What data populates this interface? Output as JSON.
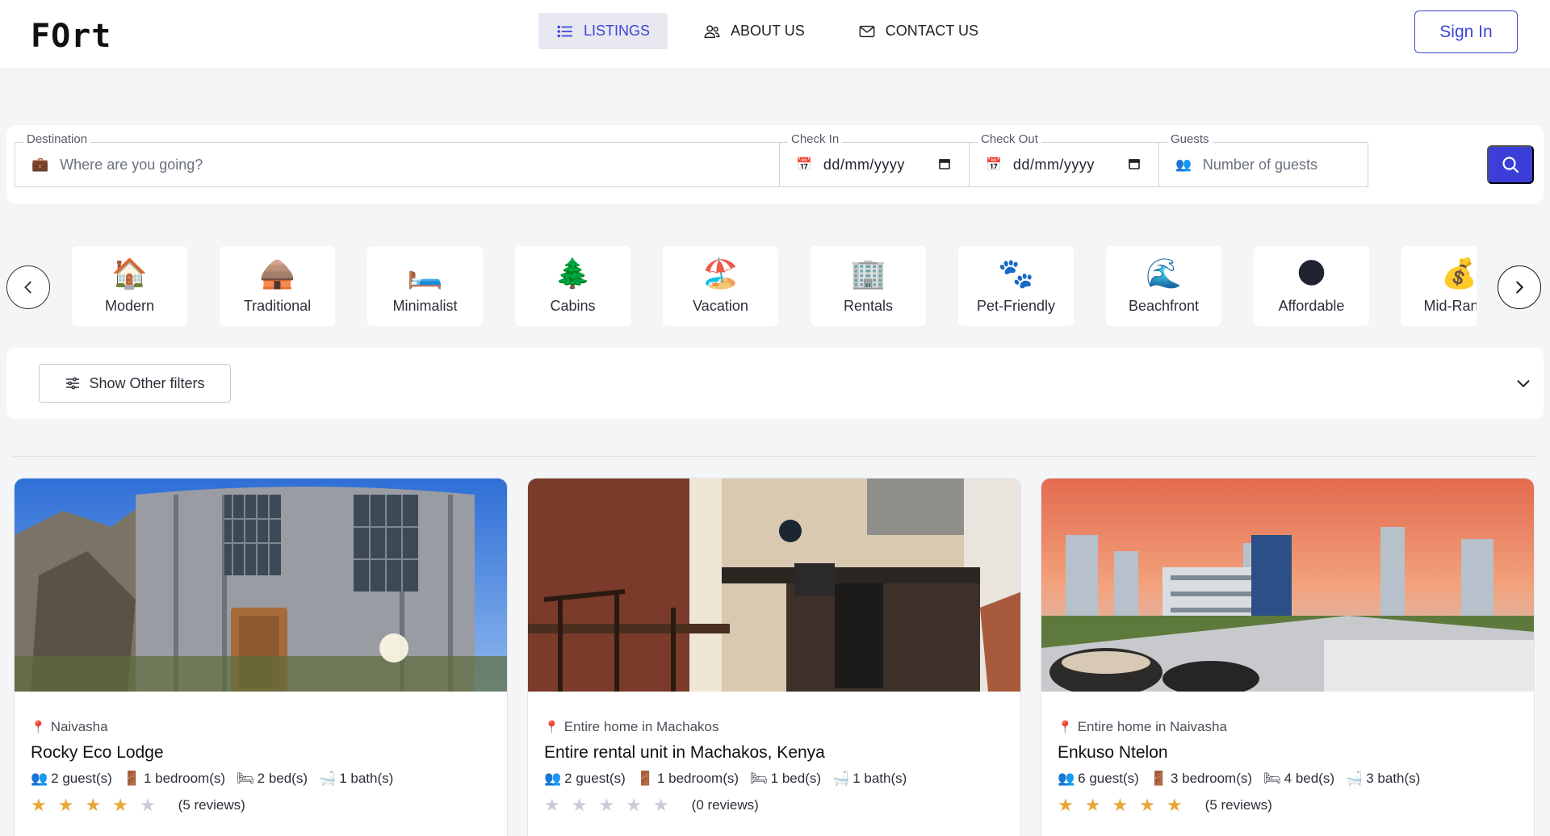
{
  "header": {
    "logo": "FOrt",
    "nav": [
      {
        "label": "LISTINGS",
        "icon": "list-icon",
        "active": true
      },
      {
        "label": "ABOUT US",
        "icon": "users-icon",
        "active": false
      },
      {
        "label": "CONTACT US",
        "icon": "mail-icon",
        "active": false
      }
    ],
    "signin_label": "Sign In"
  },
  "search": {
    "destination": {
      "label": "Destination",
      "placeholder": "Where are you going?",
      "icon": "luggage-icon"
    },
    "check_in": {
      "label": "Check In",
      "value": "dd/mm/yyyy",
      "icon": "calendar-emoji-icon"
    },
    "check_out": {
      "label": "Check Out",
      "value": "dd/mm/yyyy",
      "icon": "calendar-emoji-icon"
    },
    "guests": {
      "label": "Guests",
      "placeholder": "Number of guests",
      "icon": "people-icon"
    },
    "button_icon": "search-icon"
  },
  "categories": [
    {
      "label": "Modern",
      "emoji": "🏠"
    },
    {
      "label": "Traditional",
      "emoji": "🛖"
    },
    {
      "label": "Minimalist",
      "emoji": "🛏️"
    },
    {
      "label": "Cabins",
      "emoji": "🌲"
    },
    {
      "label": "Vacation",
      "emoji": "🏖️"
    },
    {
      "label": "Rentals",
      "emoji": "🏢"
    },
    {
      "label": "Pet-Friendly",
      "emoji": "🐾"
    },
    {
      "label": "Beachfront",
      "emoji": "🌊"
    },
    {
      "label": "Affordable",
      "emoji": "🌑"
    },
    {
      "label": "Mid-Range",
      "emoji": "💰"
    }
  ],
  "filters": {
    "show_label": "Show Other filters"
  },
  "listings": [
    {
      "location": "Naivasha",
      "title": "Rocky Eco Lodge",
      "guests": "2 guest(s)",
      "bedrooms": "1 bedroom(s)",
      "beds": "2 bed(s)",
      "baths": "1 bath(s)",
      "stars": 4,
      "reviews": "(5 reviews)"
    },
    {
      "location": "Entire home in Machakos",
      "title": "Entire rental unit in Machakos, Kenya",
      "guests": "2 guest(s)",
      "bedrooms": "1 bedroom(s)",
      "beds": "1 bed(s)",
      "baths": "1 bath(s)",
      "stars": 0,
      "reviews": "(0 reviews)"
    },
    {
      "location": "Entire home in Naivasha",
      "title": "Enkuso Ntelon",
      "guests": "6 guest(s)",
      "bedrooms": "3 bedroom(s)",
      "beds": "4 bed(s)",
      "baths": "3 bath(s)",
      "stars": 5,
      "reviews": "(5 reviews)"
    }
  ],
  "colors": {
    "accent": "#3b45d6",
    "star_on": "#e5a93a",
    "star_off": "#c9ccd6"
  }
}
